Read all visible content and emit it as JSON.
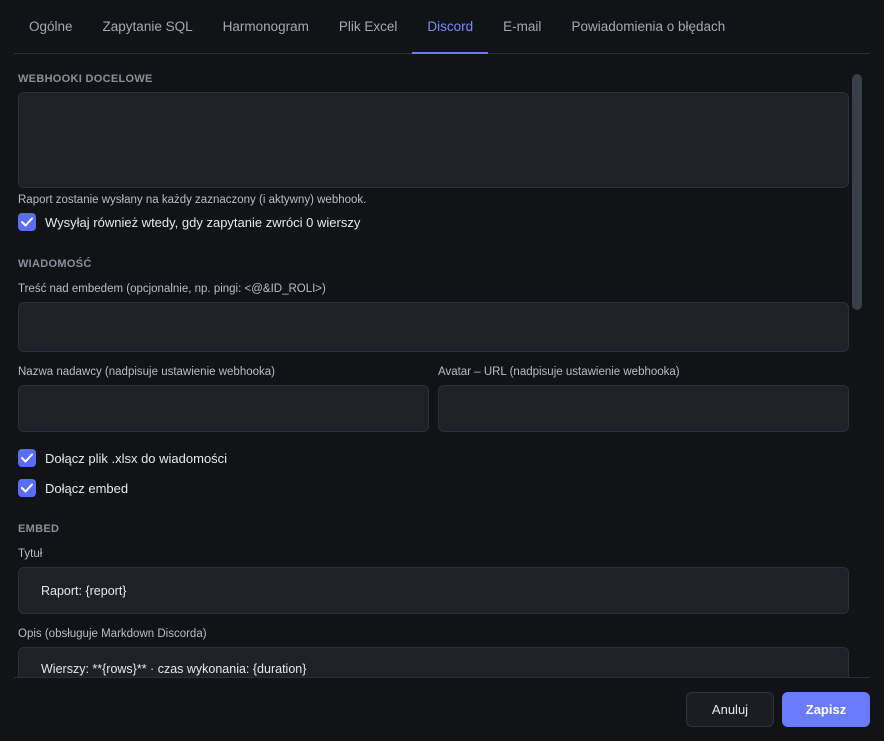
{
  "tabs": [
    {
      "label": "Ogólne"
    },
    {
      "label": "Zapytanie SQL"
    },
    {
      "label": "Harmonogram"
    },
    {
      "label": "Plik Excel"
    },
    {
      "label": "Discord",
      "active": true
    },
    {
      "label": "E-mail"
    },
    {
      "label": "Powiadomienia o błędach"
    }
  ],
  "webhooks": {
    "section_title": "WEBHOOKI DOCELOWE",
    "help": "Raport zostanie wysłany na każdy zaznaczony (i aktywny) webhook.",
    "send_empty_label": "Wysyłaj również wtedy, gdy zapytanie zwróci 0 wierszy",
    "send_empty_checked": true
  },
  "message": {
    "section_title": "WIADOMOŚĆ",
    "content_label": "Treść nad embedem (opcjonalnie, np. pingi: <@&ID_ROLI>)",
    "content_value": "",
    "sender_label": "Nazwa nadawcy (nadpisuje ustawienie webhooka)",
    "sender_value": "",
    "avatar_label": "Avatar – URL (nadpisuje ustawienie webhooka)",
    "avatar_value": "",
    "attach_xlsx_label": "Dołącz plik .xlsx do wiadomości",
    "attach_xlsx_checked": true,
    "attach_embed_label": "Dołącz embed",
    "attach_embed_checked": true
  },
  "embed": {
    "section_title": "EMBED",
    "title_label": "Tytuł",
    "title_value": "Raport: {report}",
    "description_label": "Opis (obsługuje Markdown Discorda)",
    "description_value": "Wierszy: **{rows}** · czas wykonania: {duration}"
  },
  "footer": {
    "cancel_label": "Anuluj",
    "save_label": "Zapisz"
  },
  "colors": {
    "accent": "#6b7cfb",
    "background": "#111317",
    "field_background": "#1e2128"
  }
}
